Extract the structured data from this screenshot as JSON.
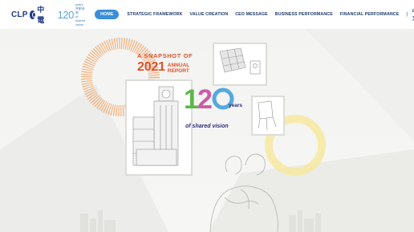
{
  "header": {
    "brand": "CLP",
    "brand_cn": "中電",
    "anniversary_number": "120",
    "anniversary_tag_line1": "years 共創未來",
    "anniversary_tag_line2": "of shared vision"
  },
  "nav": {
    "items": [
      {
        "label": "HOME",
        "active": true
      },
      {
        "label": "STRATEGIC FRAMEWORK"
      },
      {
        "label": "VALUE CREATION"
      },
      {
        "label": "CEO MESSAGE"
      },
      {
        "label": "BUSINESS PERFORMANCE"
      },
      {
        "label": "FINANCIAL PERFORMANCE"
      }
    ],
    "separator": "|",
    "language": "中文"
  },
  "hero": {
    "snapshot_line1": "A SNAPSHOT OF",
    "year": "2021",
    "annual": "ANNUAL",
    "report": "REPORT",
    "big_number": "120",
    "years_word": "years",
    "tagline": "of shared vision"
  },
  "colors": {
    "brand_blue": "#1f3a8a",
    "nav_active": "#3b8fd9",
    "snapshot_orange": "#e0502a",
    "tagline_navy": "#2f2b7d"
  }
}
